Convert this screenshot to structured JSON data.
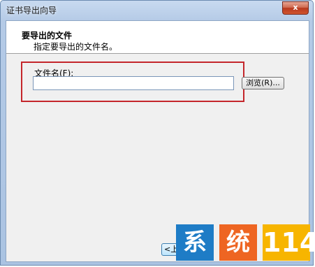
{
  "window": {
    "title": "证书导出向导",
    "close_label": "x"
  },
  "header": {
    "title": "要导出的文件",
    "subtitle": "指定要导出的文件名。"
  },
  "form": {
    "filename_label": "文件名(F):",
    "filename_value": "",
    "browse_label": "浏览(R)..."
  },
  "footer": {
    "next_label": "<上"
  },
  "watermark": {
    "char1": "系",
    "char2": "统",
    "char3": "114"
  },
  "colors": {
    "highlight_frame": "#c4262b",
    "close_button": "#c9482b",
    "wm_blue": "#1e7cc6",
    "wm_orange": "#ee6522",
    "wm_yellow": "#f7b500"
  }
}
